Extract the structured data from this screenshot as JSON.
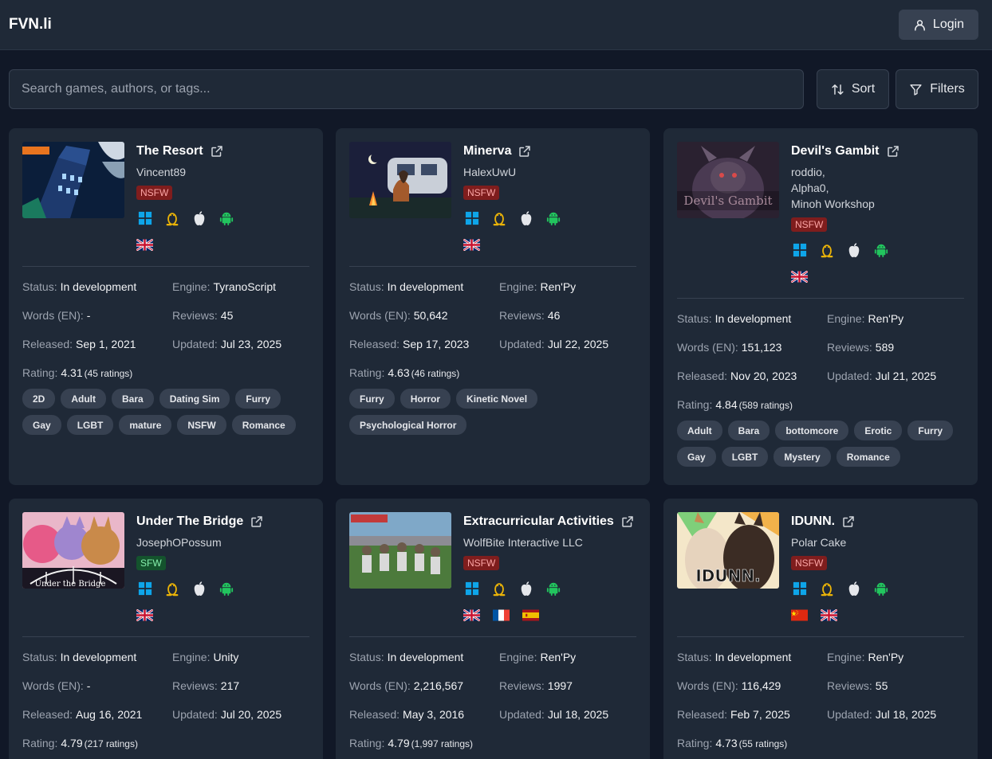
{
  "header": {
    "brand": "FVN.li",
    "login_label": "Login"
  },
  "search": {
    "placeholder": "Search games, authors, or tags..."
  },
  "toolbar": {
    "sort_label": "Sort",
    "filters_label": "Filters"
  },
  "labels": {
    "status": "Status:",
    "engine": "Engine:",
    "words": "Words (EN):",
    "reviews": "Reviews:",
    "released": "Released:",
    "updated": "Updated:",
    "rating": "Rating:"
  },
  "colors": {
    "nsfw": "#7f1d1d",
    "sfw": "#14532d",
    "windows": "#0ea5e9",
    "linux": "#eab308",
    "apple": "#e5e7eb",
    "android": "#22c55e"
  },
  "games": [
    {
      "title": "The Resort",
      "authors": [
        "Vincent89"
      ],
      "rating_badge": "NSFW",
      "cover_icon": "cover-city-night",
      "platforms": [
        "windows-icon",
        "linux-icon",
        "apple-icon",
        "android-icon"
      ],
      "languages": [
        "uk-flag-icon"
      ],
      "status": "In development",
      "engine": "TyranoScript",
      "words": "-",
      "reviews": "45",
      "released": "Sep 1, 2021",
      "updated": "Jul 23, 2025",
      "rating": "4.31",
      "rating_count": "(45 ratings)",
      "tags": [
        "2D",
        "Adult",
        "Bara",
        "Dating Sim",
        "Furry",
        "Gay",
        "LGBT",
        "mature",
        "NSFW",
        "Romance"
      ]
    },
    {
      "title": "Minerva",
      "authors": [
        "HalexUwU"
      ],
      "rating_badge": "NSFW",
      "cover_icon": "cover-campfire-night",
      "platforms": [
        "windows-icon",
        "linux-icon",
        "apple-icon",
        "android-icon"
      ],
      "languages": [
        "uk-flag-icon"
      ],
      "status": "In development",
      "engine": "Ren'Py",
      "words": "50,642",
      "reviews": "46",
      "released": "Sep 17, 2023",
      "updated": "Jul 22, 2025",
      "rating": "4.63",
      "rating_count": "(46 ratings)",
      "tags": [
        "Furry",
        "Horror",
        "Kinetic Novel",
        "Psychological Horror"
      ]
    },
    {
      "title": "Devil's Gambit",
      "authors": [
        "roddio,",
        "Alpha0,",
        "Minoh Workshop"
      ],
      "rating_badge": "NSFW",
      "cover_icon": "cover-demon",
      "platforms": [
        "windows-icon",
        "linux-icon",
        "apple-icon",
        "android-icon"
      ],
      "languages": [
        "uk-flag-icon"
      ],
      "status": "In development",
      "engine": "Ren'Py",
      "words": "151,123",
      "reviews": "589",
      "released": "Nov 20, 2023",
      "updated": "Jul 21, 2025",
      "rating": "4.84",
      "rating_count": "(589 ratings)",
      "tags": [
        "Adult",
        "Bara",
        "bottomcore",
        "Erotic",
        "Furry",
        "Gay",
        "LGBT",
        "Mystery",
        "Romance"
      ]
    },
    {
      "title": "Under The Bridge",
      "authors": [
        "JosephOPossum"
      ],
      "rating_badge": "SFW",
      "cover_icon": "cover-bridge-characters",
      "platforms": [
        "windows-icon",
        "linux-icon",
        "apple-icon",
        "android-icon"
      ],
      "languages": [
        "uk-flag-icon"
      ],
      "status": "In development",
      "engine": "Unity",
      "words": "-",
      "reviews": "217",
      "released": "Aug 16, 2021",
      "updated": "Jul 20, 2025",
      "rating": "4.79",
      "rating_count": "(217 ratings)",
      "tags": []
    },
    {
      "title": "Extracurricular Activities",
      "authors": [
        "WolfBite Interactive LLC"
      ],
      "rating_badge": "NSFW",
      "cover_icon": "cover-sports-field",
      "platforms": [
        "windows-icon",
        "linux-icon",
        "apple-icon",
        "android-icon"
      ],
      "languages": [
        "uk-flag-icon",
        "france-flag-icon",
        "spain-flag-icon"
      ],
      "status": "In development",
      "engine": "Ren'Py",
      "words": "2,216,567",
      "reviews": "1997",
      "released": "May 3, 2016",
      "updated": "Jul 18, 2025",
      "rating": "4.79",
      "rating_count": "(1,997 ratings)",
      "tags": []
    },
    {
      "title": "IDUNN.",
      "authors": [
        "Polar Cake"
      ],
      "rating_badge": "NSFW",
      "cover_icon": "cover-idunn",
      "platforms": [
        "windows-icon",
        "linux-icon",
        "apple-icon",
        "android-icon"
      ],
      "languages": [
        "china-flag-icon",
        "uk-flag-icon"
      ],
      "status": "In development",
      "engine": "Ren'Py",
      "words": "116,429",
      "reviews": "55",
      "released": "Feb 7, 2025",
      "updated": "Jul 18, 2025",
      "rating": "4.73",
      "rating_count": "(55 ratings)",
      "tags": []
    }
  ]
}
